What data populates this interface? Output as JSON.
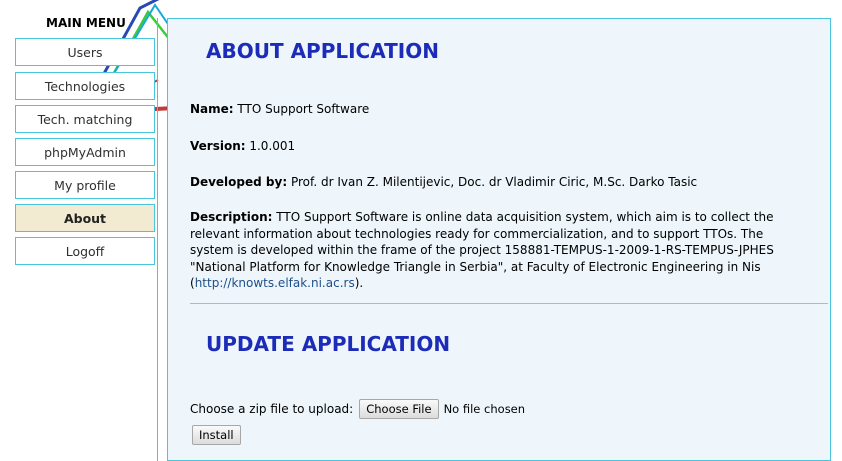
{
  "sidebar": {
    "title": "MAIN MENU",
    "items": [
      {
        "label": "Users",
        "active": false
      },
      {
        "label": "Technologies",
        "active": false
      },
      {
        "label": "Tech. matching",
        "active": false
      },
      {
        "label": "phpMyAdmin",
        "active": false
      },
      {
        "label": "My profile",
        "active": false
      },
      {
        "label": "About",
        "active": true
      },
      {
        "label": "Logoff",
        "active": false
      }
    ]
  },
  "about": {
    "heading": "ABOUT APPLICATION",
    "name_label": "Name:",
    "name_value": "TTO Support Software",
    "version_label": "Version:",
    "version_value": "1.0.001",
    "developed_label": "Developed by:",
    "developed_value": "Prof. dr Ivan Z. Milentijevic, Doc. dr Vladimir Ciric, M.Sc. Darko Tasic",
    "description_label": "Description:",
    "description_text": "TTO Support Software is online data acquisition system, which aim is to collect the relevant information about technologies ready for commercialization, and to support TTOs. The system is developed within the frame of the project 158881-TEMPUS-1-2009-1-RS-TEMPUS-JPHES \"National Platform for Knowledge Triangle in Serbia\", at Faculty of Electronic Engineering in Nis (",
    "description_link": "http://knowts.elfak.ni.ac.rs",
    "description_end": ")."
  },
  "update": {
    "heading": "UPDATE APPLICATION",
    "choose_label": "Choose a zip file to upload:",
    "choose_button": "Choose File",
    "file_status": "No file chosen",
    "install_button": "Install"
  },
  "colors": {
    "accent": "#48c6de",
    "heading": "#1d2cb8",
    "panel_bg": "#eef6fb",
    "active_item_bg": "#f3ead2"
  }
}
